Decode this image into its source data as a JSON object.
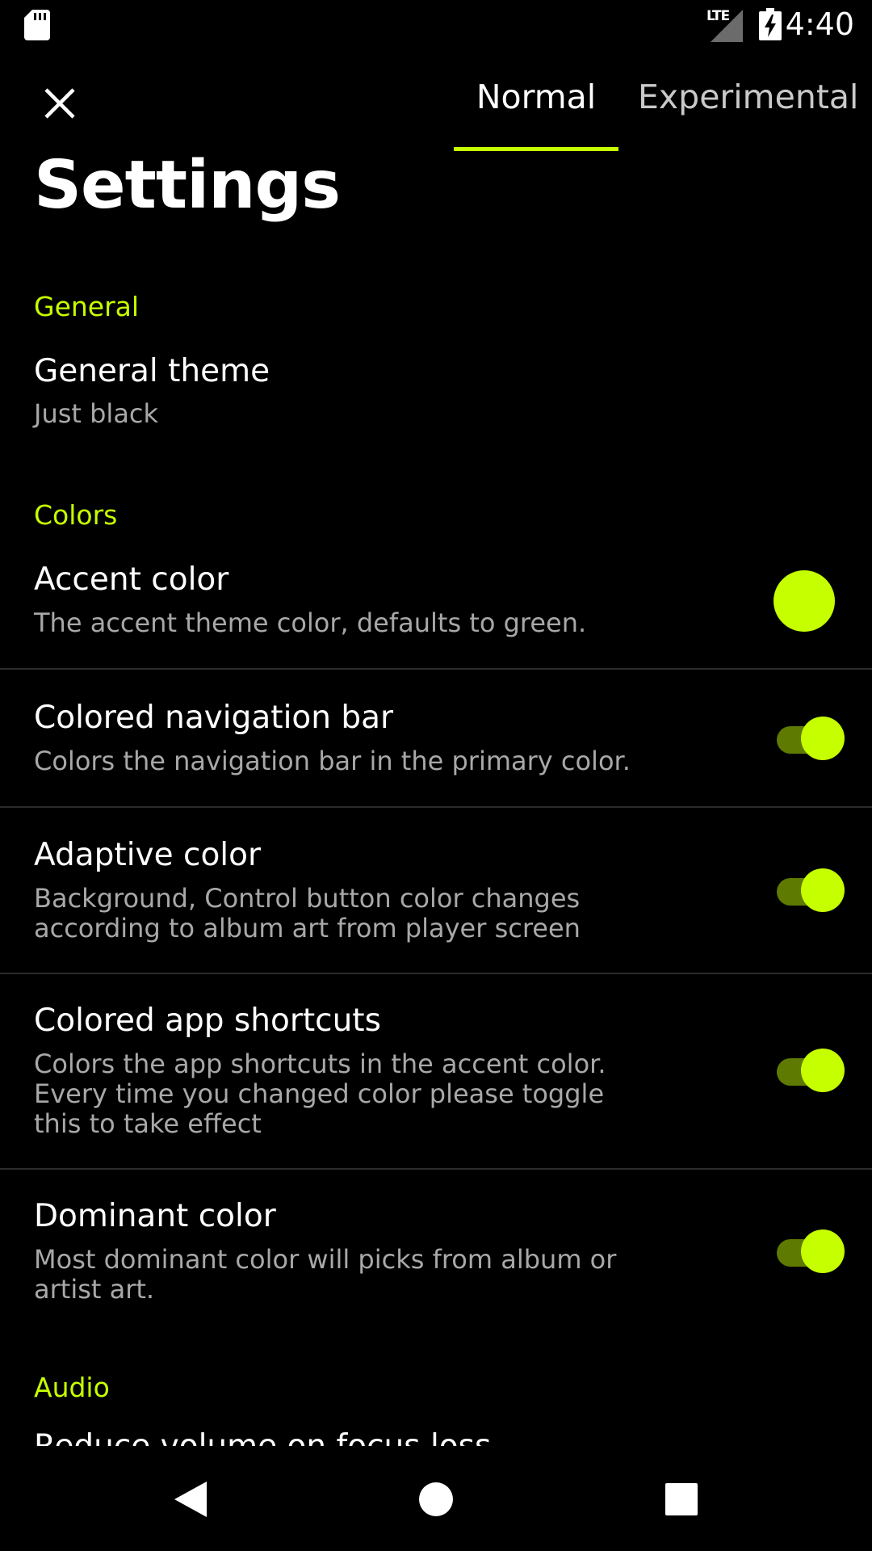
{
  "status_bar": {
    "time": "4:40",
    "network": "LTE",
    "icons": [
      "sd-card-icon",
      "signal-icon",
      "battery-charging-icon"
    ]
  },
  "toolbar": {
    "close_icon": "close-icon",
    "tabs": [
      {
        "label": "Normal",
        "selected": true
      },
      {
        "label": "Experimental",
        "selected": false
      }
    ]
  },
  "page": {
    "title": "Settings"
  },
  "sections": {
    "general": {
      "header": "General",
      "items": [
        {
          "title": "General theme",
          "summary": "Just black"
        }
      ]
    },
    "colors": {
      "header": "Colors",
      "items": [
        {
          "title": "Accent color",
          "summary": "The accent theme color, defaults to green.",
          "widget": "color-swatch",
          "value": "#c6ff00"
        },
        {
          "title": "Colored navigation bar",
          "summary": "Colors the navigation bar in the primary color.",
          "widget": "switch",
          "checked": true
        },
        {
          "title": "Adaptive color",
          "summary": "Background, Control button color changes according to album art from player screen",
          "widget": "switch",
          "checked": true
        },
        {
          "title": "Colored app shortcuts",
          "summary": "Colors the app shortcuts in the accent color. Every time you changed color please toggle this to take effect",
          "widget": "switch",
          "checked": true
        },
        {
          "title": "Dominant color",
          "summary": "Most dominant color will picks from album or artist art.",
          "widget": "switch",
          "checked": true
        }
      ]
    },
    "audio": {
      "header": "Audio",
      "items": [
        {
          "title": "Reduce volume on focus loss"
        }
      ]
    }
  },
  "nav_bar": {
    "buttons": [
      "back-icon",
      "home-icon",
      "recents-icon"
    ]
  },
  "colors": {
    "background": "#000000",
    "accent": "#c6ff00",
    "switch_track": "#5f7a00",
    "summary_text": "#a8a8a8",
    "divider": "#2b2b2b"
  }
}
